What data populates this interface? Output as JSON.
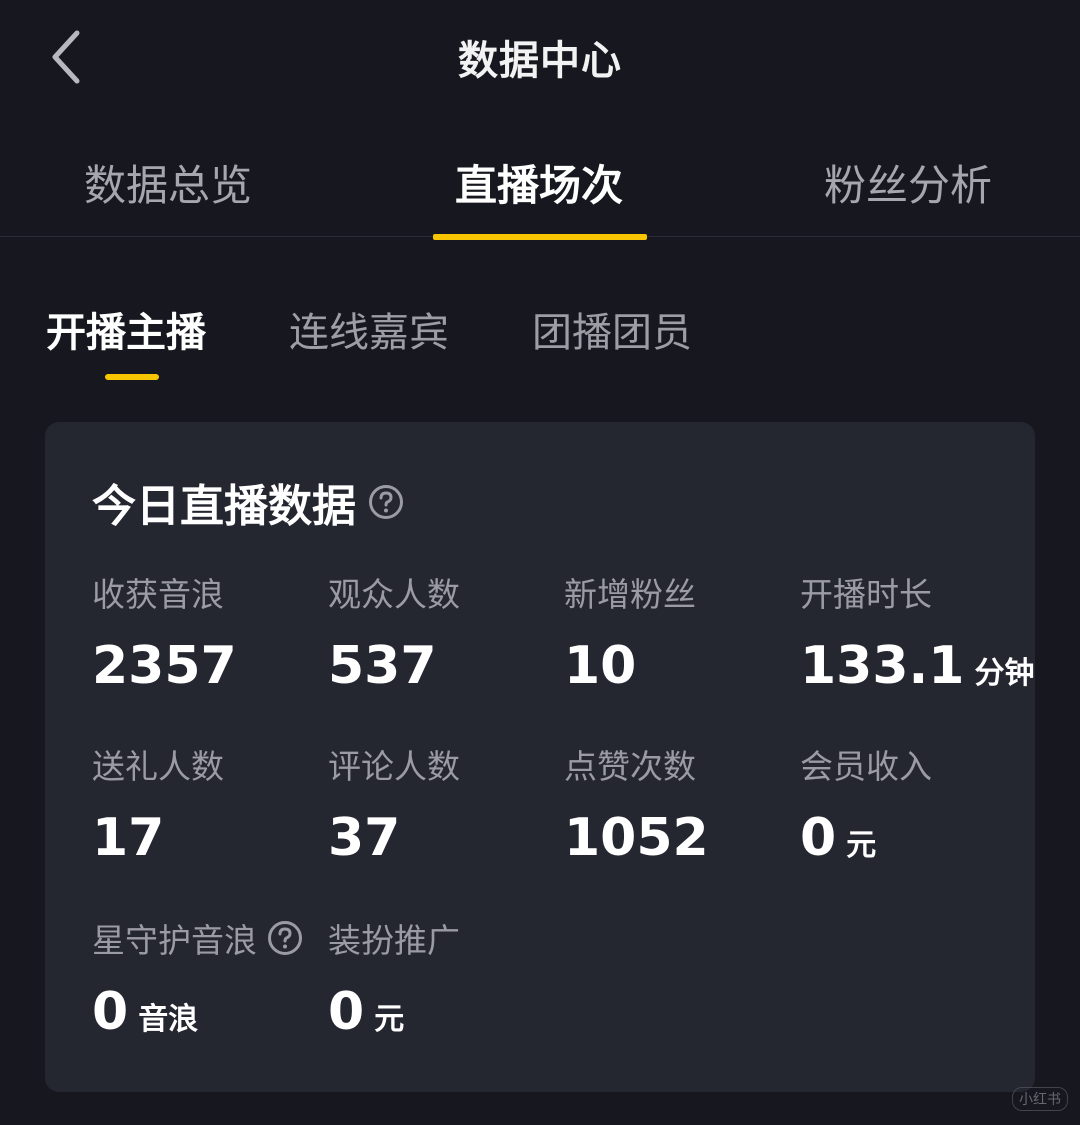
{
  "header": {
    "title": "数据中心",
    "back_icon": "chevron-left-icon"
  },
  "main_tabs": [
    {
      "label": "数据总览",
      "active": false
    },
    {
      "label": "直播场次",
      "active": true
    },
    {
      "label": "粉丝分析",
      "active": false
    }
  ],
  "sub_tabs": [
    {
      "label": "开播主播",
      "active": true
    },
    {
      "label": "连线嘉宾",
      "active": false
    },
    {
      "label": "团播团员",
      "active": false
    }
  ],
  "card": {
    "title": "今日直播数据",
    "metrics": [
      {
        "label": "收获音浪",
        "value": "2357",
        "unit": ""
      },
      {
        "label": "观众人数",
        "value": "537",
        "unit": ""
      },
      {
        "label": "新增粉丝",
        "value": "10",
        "unit": ""
      },
      {
        "label": "开播时长",
        "value": "133.1",
        "unit": "分钟"
      },
      {
        "label": "送礼人数",
        "value": "17",
        "unit": ""
      },
      {
        "label": "评论人数",
        "value": "37",
        "unit": ""
      },
      {
        "label": "点赞次数",
        "value": "1052",
        "unit": ""
      },
      {
        "label": "会员收入",
        "value": "0",
        "unit": "元"
      },
      {
        "label": "星守护音浪",
        "value": "0",
        "unit": "音浪",
        "has_help": true
      },
      {
        "label": "装扮推广",
        "value": "0",
        "unit": "元"
      }
    ]
  },
  "watermark": "小红书",
  "colors": {
    "background": "#16171f",
    "card": "#242630",
    "accent": "#f7c600",
    "label": "#9a9ba3"
  }
}
